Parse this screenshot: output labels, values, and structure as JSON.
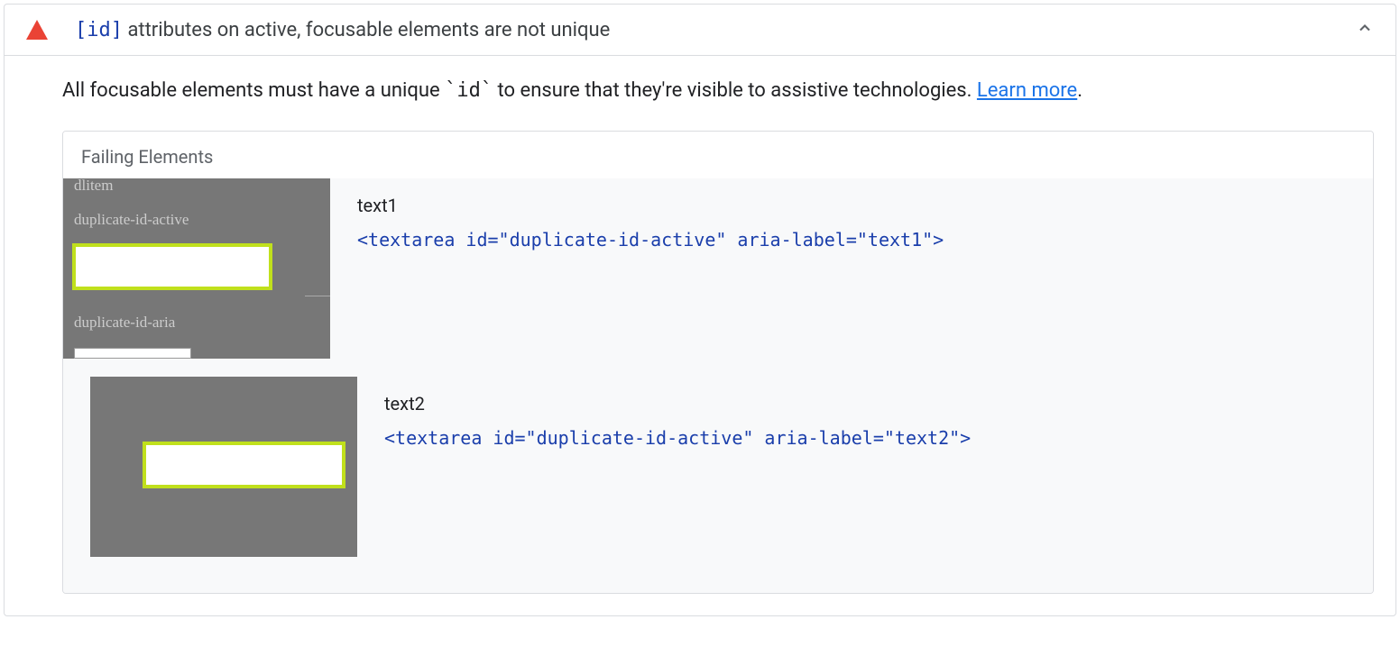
{
  "audit": {
    "title_code": "[id]",
    "title_text": " attributes on active, focusable elements are not unique",
    "description_pre": "All focusable elements must have a unique ",
    "description_code": "`id`",
    "description_post": " to ensure that they're visible to assistive technologies. ",
    "learn_more": "Learn more",
    "period": "."
  },
  "failing": {
    "header": "Failing Elements",
    "items": [
      {
        "label": "text1",
        "code": "<textarea id=\"duplicate-id-active\" aria-label=\"text1\">",
        "thumb_text_top": "dlitem",
        "thumb_text_mid": "duplicate-id-active",
        "thumb_text_bottom": "duplicate-id-aria"
      },
      {
        "label": "text2",
        "code": "<textarea id=\"duplicate-id-active\" aria-label=\"text2\">"
      }
    ]
  }
}
